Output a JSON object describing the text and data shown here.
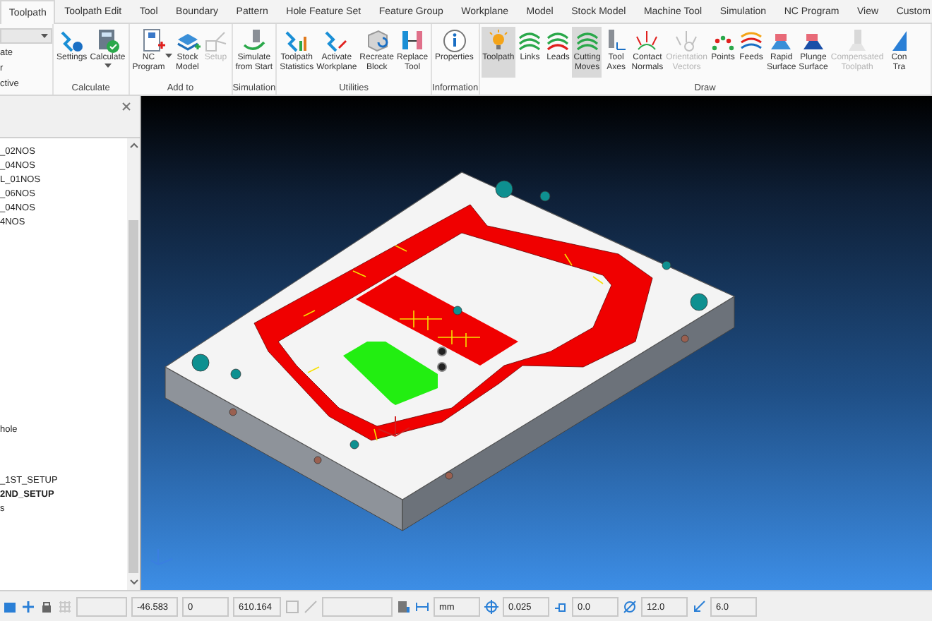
{
  "tabs": [
    {
      "label": "Toolpath",
      "selected": true
    },
    {
      "label": "Toolpath Edit",
      "selected": false
    },
    {
      "label": "Tool",
      "selected": false
    },
    {
      "label": "Boundary",
      "selected": false
    },
    {
      "label": "Pattern",
      "selected": false
    },
    {
      "label": "Hole Feature Set",
      "selected": false
    },
    {
      "label": "Feature Group",
      "selected": false
    },
    {
      "label": "Workplane",
      "selected": false
    },
    {
      "label": "Model",
      "selected": false
    },
    {
      "label": "Stock Model",
      "selected": false
    },
    {
      "label": "Machine Tool",
      "selected": false
    },
    {
      "label": "Simulation",
      "selected": false
    },
    {
      "label": "NC Program",
      "selected": false
    },
    {
      "label": "View",
      "selected": false
    },
    {
      "label": "Custom",
      "selected": false
    }
  ],
  "ribbon": {
    "cut_group": {
      "lines": [
        "ate",
        "r",
        "ctive"
      ]
    },
    "groups": [
      {
        "label": "Calculate",
        "buttons": [
          {
            "label": "Settings",
            "selected": false,
            "disabled": false,
            "dropdown": false
          },
          {
            "label": "Calculate",
            "selected": false,
            "disabled": false,
            "dropdown": true
          }
        ]
      },
      {
        "label": "Add to",
        "buttons": [
          {
            "label": "NC\nProgram",
            "selected": false,
            "disabled": false,
            "dropdown": true
          },
          {
            "label": "Stock\nModel",
            "selected": false,
            "disabled": false,
            "dropdown": false
          },
          {
            "label": "Setup",
            "selected": false,
            "disabled": true,
            "dropdown": false
          }
        ]
      },
      {
        "label": "Simulation",
        "buttons": [
          {
            "label": "Simulate\nfrom Start",
            "selected": false,
            "disabled": false,
            "dropdown": false
          }
        ]
      },
      {
        "label": "Utilities",
        "buttons": [
          {
            "label": "Toolpath\nStatistics",
            "selected": false,
            "disabled": false,
            "dropdown": false
          },
          {
            "label": "Activate\nWorkplane",
            "selected": false,
            "disabled": false,
            "dropdown": false
          },
          {
            "label": "Recreate\nBlock",
            "selected": false,
            "disabled": false,
            "dropdown": false
          },
          {
            "label": "Replace\nTool",
            "selected": false,
            "disabled": false,
            "dropdown": false
          }
        ]
      },
      {
        "label": "Information",
        "buttons": [
          {
            "label": "Properties",
            "selected": false,
            "disabled": false,
            "dropdown": false
          }
        ]
      },
      {
        "label": "Draw",
        "buttons": [
          {
            "label": "Toolpath",
            "selected": true,
            "disabled": false,
            "dropdown": false
          },
          {
            "label": "Links",
            "selected": false,
            "disabled": false,
            "dropdown": false
          },
          {
            "label": "Leads",
            "selected": false,
            "disabled": false,
            "dropdown": false
          },
          {
            "label": "Cutting\nMoves",
            "selected": true,
            "disabled": false,
            "dropdown": false
          },
          {
            "label": "Tool\nAxes",
            "selected": false,
            "disabled": false,
            "dropdown": false
          },
          {
            "label": "Contact\nNormals",
            "selected": false,
            "disabled": false,
            "dropdown": false
          },
          {
            "label": "Orientation\nVectors",
            "selected": false,
            "disabled": true,
            "dropdown": false
          },
          {
            "label": "Points",
            "selected": false,
            "disabled": false,
            "dropdown": false
          },
          {
            "label": "Feeds",
            "selected": false,
            "disabled": false,
            "dropdown": false
          },
          {
            "label": "Rapid\nSurface",
            "selected": false,
            "disabled": false,
            "dropdown": false
          },
          {
            "label": "Plunge\nSurface",
            "selected": false,
            "disabled": false,
            "dropdown": false
          },
          {
            "label": "Compensated\nToolpath",
            "selected": false,
            "disabled": true,
            "dropdown": false
          },
          {
            "label": "Con\nTra",
            "selected": false,
            "disabled": false,
            "dropdown": false
          }
        ]
      }
    ]
  },
  "tree": {
    "blocks": [
      {
        "items": [
          {
            "label": "_02NOS",
            "active": false
          },
          {
            "label": "_04NOS",
            "active": false
          },
          {
            "label": "L_01NOS",
            "active": false
          },
          {
            "label": "_06NOS",
            "active": false
          },
          {
            "label": "_04NOS",
            "active": false
          },
          {
            "label": "4NOS",
            "active": false
          }
        ]
      },
      {
        "items": [
          {
            "label": "hole",
            "active": false
          }
        ]
      },
      {
        "items": [
          {
            "label": "_1ST_SETUP",
            "active": false
          },
          {
            "label": "2ND_SETUP",
            "active": true
          },
          {
            "label": "s",
            "active": false
          }
        ]
      }
    ]
  },
  "status_bar": {
    "fields": [
      {
        "value": "-46.583"
      },
      {
        "value": "0"
      },
      {
        "value": "610.164"
      },
      {
        "value": "mm"
      },
      {
        "value": "0.025"
      },
      {
        "value": "0.0"
      },
      {
        "value": "12.0"
      },
      {
        "value": "6.0"
      }
    ]
  }
}
